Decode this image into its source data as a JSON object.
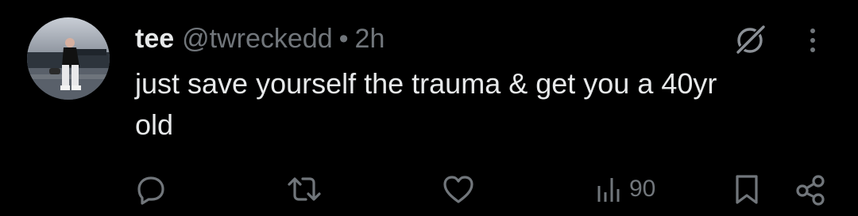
{
  "tweet": {
    "display_name": "tee",
    "handle": "@twreckedd",
    "separator": "•",
    "time": "2h",
    "text_line1": "just save yourself the trauma & get you a 40yr",
    "text_line2": "old"
  },
  "actions": {
    "reply_icon": "reply-icon",
    "retweet_icon": "retweet-icon",
    "like_icon": "heart-icon",
    "views_icon": "views-icon",
    "views_count": "90",
    "bookmark_icon": "bookmark-icon",
    "share_icon": "share-icon"
  },
  "header_icons": {
    "grok": "grok-icon",
    "more": "more-vertical-icon"
  },
  "colors": {
    "background": "#000000",
    "primary_text": "#e7e9ea",
    "secondary_text": "#71767b"
  }
}
